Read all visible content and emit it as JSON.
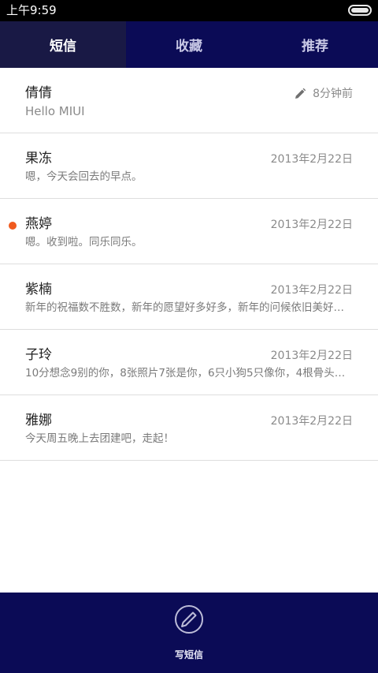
{
  "status_bar": {
    "time": "上午9:59"
  },
  "tabs": [
    {
      "label": "短信",
      "active": true
    },
    {
      "label": "收藏",
      "active": false
    },
    {
      "label": "推荐",
      "active": false
    }
  ],
  "conversations": [
    {
      "name": "倩倩",
      "date": "8分钟前",
      "preview": "Hello MIUI",
      "draft": true,
      "unread": false
    },
    {
      "name": "果冻",
      "date": "2013年2月22日",
      "preview": "嗯，今天会回去的早点。",
      "draft": false,
      "unread": false
    },
    {
      "name": "燕婷",
      "date": "2013年2月22日",
      "preview": "嗯。收到啦。同乐同乐。",
      "draft": false,
      "unread": true
    },
    {
      "name": "紫楠",
      "date": "2013年2月22日",
      "preview": "新年的祝福数不胜数，新年的愿望好多好多，新年的问候依旧美好…",
      "draft": false,
      "unread": false
    },
    {
      "name": "子玲",
      "date": "2013年2月22日",
      "preview": "10分想念9别的你，8张照片7张是你，6只小狗5只像你，4根骨头…",
      "draft": false,
      "unread": false
    },
    {
      "name": "雅娜",
      "date": "2013年2月22日",
      "preview": "今天周五晚上去团建吧，走起！",
      "draft": false,
      "unread": false
    }
  ],
  "bottom_bar": {
    "compose_label": "写短信",
    "compose_icon": "compose-icon"
  },
  "colors": {
    "header_bg": "#0b0b56",
    "active_tab_bg": "#191945",
    "unread_dot": "#f05a1e"
  }
}
